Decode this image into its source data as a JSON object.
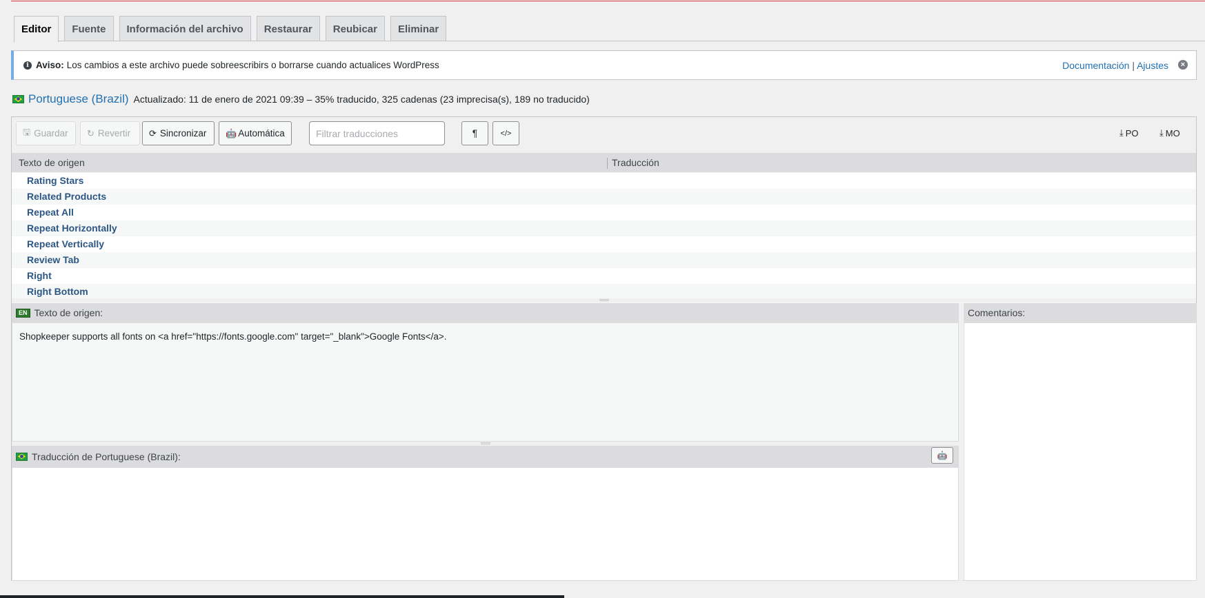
{
  "tabs": [
    {
      "label": "Editor",
      "active": true
    },
    {
      "label": "Fuente"
    },
    {
      "label": "Información del archivo"
    },
    {
      "label": "Restaurar"
    },
    {
      "label": "Reubicar"
    },
    {
      "label": "Eliminar"
    }
  ],
  "notice": {
    "label": "Aviso:",
    "text": "Los cambios a este archivo puede sobreescribirs o borrarse cuando actualices WordPress",
    "link_docs": "Documentación",
    "divider": "|",
    "link_settings": "Ajustes",
    "dismiss": "×"
  },
  "language": {
    "name": "Portuguese (Brazil)",
    "meta": "Actualizado: 11 de enero de 2021 09:39 – 35% traducido, 325 cadenas (23 imprecisa(s), 189 no traducido)"
  },
  "toolbar": {
    "save": "Guardar",
    "revert": "Revertir",
    "sync": "Sincronizar",
    "auto": "Automática",
    "filter_placeholder": "Filtrar traducciones",
    "pilcrow": "¶",
    "code": "</>",
    "po": "PO",
    "mo": "MO"
  },
  "list": {
    "col_source": "Texto de origen",
    "col_translation": "Traducción",
    "rows": [
      "Rating Stars",
      "Related Products",
      "Repeat All",
      "Repeat Horizontally",
      "Repeat Vertically",
      "Review Tab",
      "Right",
      "Right Bottom"
    ]
  },
  "source_pane": {
    "badge": "EN",
    "label": "Texto de origen:",
    "text": "Shopkeeper supports all fonts on <a href=\"https://fonts.google.com\" target=\"_blank\">Google Fonts</a>."
  },
  "translation_pane": {
    "label": "Traducción de Portuguese (Brazil):"
  },
  "comments_pane": {
    "label": "Comentarios:"
  }
}
